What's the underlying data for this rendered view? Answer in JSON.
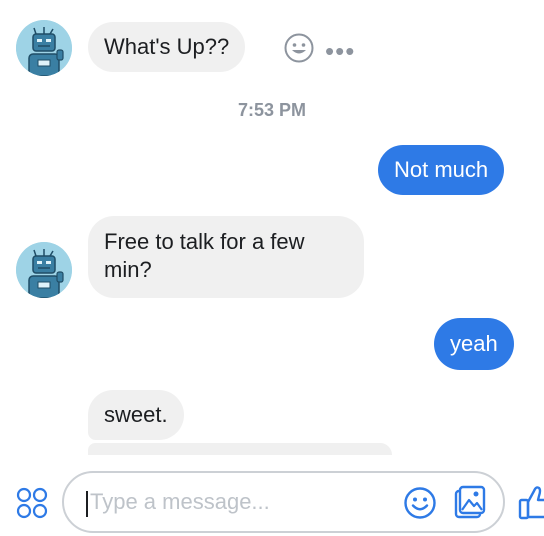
{
  "messages": [
    {
      "direction": "incoming",
      "text": "What's Up??"
    },
    {
      "direction": "outgoing",
      "text": "Not much"
    },
    {
      "direction": "incoming",
      "text_line1": "Free to talk for a few",
      "text_line2": "min?"
    },
    {
      "direction": "outgoing",
      "text": "yeah"
    },
    {
      "direction": "incoming",
      "text": "sweet."
    }
  ],
  "timestamp": "7:53 PM",
  "message_actions": {
    "react_icon": "smiley-face-icon",
    "more_label": "•••"
  },
  "composer": {
    "placeholder": "Type a message...",
    "apps_icon": "apps-grid-icon",
    "emoji_icon": "emoji-icon",
    "gif_icon": "gif-image-icon",
    "like_icon": "thumbs-up-icon"
  },
  "colors": {
    "accent": "#2e7ae6",
    "incoming_bubble": "#f0f0f0",
    "muted": "#8d949e"
  }
}
